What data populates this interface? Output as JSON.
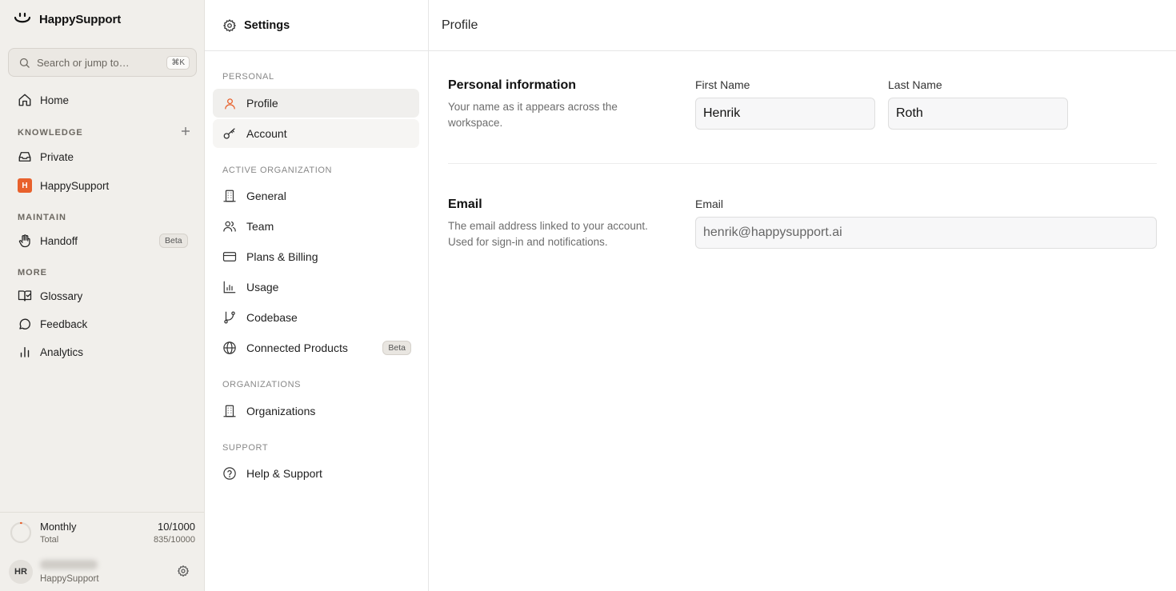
{
  "brand": {
    "name": "HappySupport"
  },
  "search": {
    "placeholder": "Search or jump to…",
    "shortcut": "⌘K"
  },
  "sidebar": {
    "home": "Home",
    "knowledge_label": "KNOWLEDGE",
    "private": "Private",
    "org_item": "HappySupport",
    "org_initial": "H",
    "maintain_label": "MAINTAIN",
    "handoff": "Handoff",
    "handoff_badge": "Beta",
    "more_label": "MORE",
    "glossary": "Glossary",
    "feedback": "Feedback",
    "analytics": "Analytics"
  },
  "usage": {
    "title": "Monthly",
    "subtitle": "Total",
    "value": "10/1000",
    "total": "835/10000",
    "progress": 0.01
  },
  "user": {
    "initials": "HR",
    "org": "HappySupport"
  },
  "settings": {
    "title": "Settings",
    "personal_label": "PERSONAL",
    "profile": "Profile",
    "account": "Account",
    "active_org_label": "ACTIVE ORGANIZATION",
    "general": "General",
    "team": "Team",
    "plans": "Plans & Billing",
    "usage": "Usage",
    "codebase": "Codebase",
    "connected": "Connected Products",
    "connected_badge": "Beta",
    "orgs_label": "ORGANIZATIONS",
    "organizations": "Organizations",
    "support_label": "SUPPORT",
    "help": "Help & Support"
  },
  "main": {
    "title": "Profile",
    "personal": {
      "title": "Personal information",
      "desc": "Your name as it appears across the workspace.",
      "first_label": "First Name",
      "first_value": "Henrik",
      "last_label": "Last Name",
      "last_value": "Roth"
    },
    "email": {
      "title": "Email",
      "desc": "The email address linked to your account. Used for sign-in and notifications.",
      "label": "Email",
      "value": "henrik@happysupport.ai"
    }
  },
  "colors": {
    "accent": "#e8612c",
    "sidebar_bg": "#f1efeb",
    "active_bg": "#f0efed"
  }
}
